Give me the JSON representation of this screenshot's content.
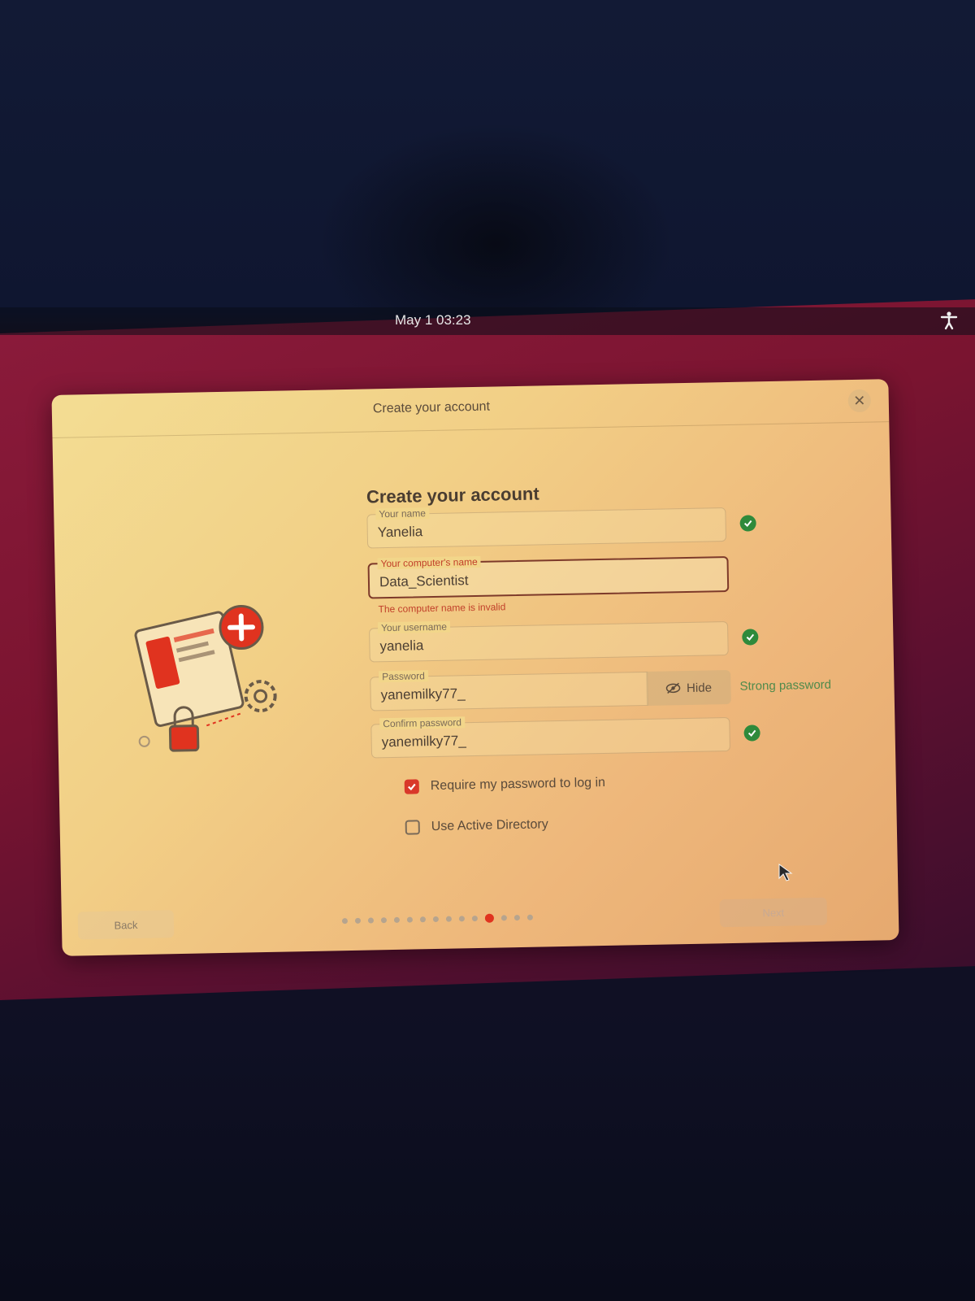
{
  "topbar": {
    "clock": "May 1  03:23",
    "accessibility_icon": "accessibility-icon"
  },
  "window": {
    "title": "Create your account",
    "close_icon": "close-icon"
  },
  "form": {
    "heading": "Create your account",
    "name": {
      "label": "Your name",
      "value": "Yanelia",
      "valid": true
    },
    "computer_name": {
      "label": "Your computer's name",
      "value": "Data_Scientist",
      "error": "The computer name is invalid"
    },
    "username": {
      "label": "Your username",
      "value": "yanelia",
      "valid": true
    },
    "password": {
      "label": "Password",
      "value": "yanemilky77_",
      "toggle_label": "Hide",
      "strength": "Strong password"
    },
    "confirm_password": {
      "label": "Confirm password",
      "value": "yanemilky77_",
      "valid": true
    },
    "require_password": {
      "label": "Require my password to log in",
      "checked": true
    },
    "active_directory": {
      "label": "Use Active Directory",
      "checked": false
    }
  },
  "footer": {
    "back_label": "Back",
    "next_label": "Next",
    "progress": {
      "total_steps": 15,
      "current_step": 12
    }
  },
  "colors": {
    "accent": "#e0331f",
    "valid": "#2f8a3b",
    "error": "#c1402a"
  }
}
